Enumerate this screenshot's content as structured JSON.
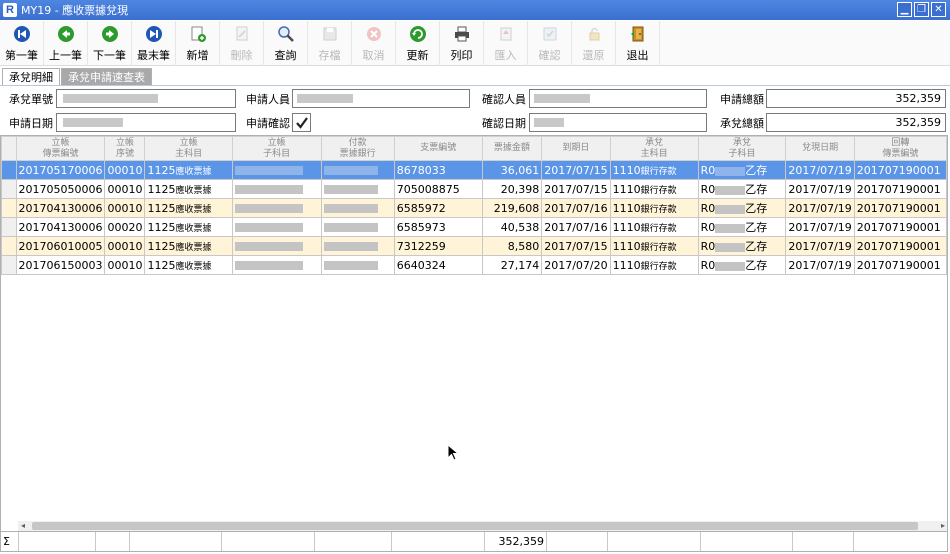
{
  "window": {
    "title": "MY19 - 應收票據兌現",
    "app_letter": "R"
  },
  "window_buttons": [
    "minimize-icon",
    "restore-icon",
    "close-icon"
  ],
  "toolbar": [
    {
      "label": "第一筆",
      "icon": "first-record-icon",
      "enabled": true
    },
    {
      "label": "上一筆",
      "icon": "previous-record-icon",
      "enabled": true
    },
    {
      "label": "下一筆",
      "icon": "next-record-icon",
      "enabled": true
    },
    {
      "label": "最末筆",
      "icon": "last-record-icon",
      "enabled": true
    },
    {
      "label": "新增",
      "icon": "add-document-icon",
      "enabled": true
    },
    {
      "label": "刪除",
      "icon": "delete-document-icon",
      "enabled": false
    },
    {
      "label": "查詢",
      "icon": "search-icon",
      "enabled": true
    },
    {
      "label": "存檔",
      "icon": "save-icon",
      "enabled": false
    },
    {
      "label": "取消",
      "icon": "cancel-icon",
      "enabled": false
    },
    {
      "label": "更新",
      "icon": "refresh-icon",
      "enabled": true
    },
    {
      "label": "列印",
      "icon": "printer-icon",
      "enabled": true
    },
    {
      "label": "匯入",
      "icon": "import-icon",
      "enabled": false
    },
    {
      "label": "確認",
      "icon": "confirm-icon",
      "enabled": false
    },
    {
      "label": "還原",
      "icon": "restore-lock-icon",
      "enabled": false
    },
    {
      "label": "退出",
      "icon": "exit-door-icon",
      "enabled": true
    }
  ],
  "tabs": [
    {
      "label": "承兌明細",
      "active": true
    },
    {
      "label": "承兌申請速查表",
      "active": false
    }
  ],
  "form": {
    "doc_no_label": "承兌單號",
    "apply_person_label": "申請人員",
    "confirm_person_label": "確認人員",
    "apply_total_label": "申請總額",
    "apply_total_value": "352,359",
    "apply_date_label": "申請日期",
    "apply_confirm_label": "申請確認",
    "apply_confirm_checked": true,
    "confirm_date_label": "確認日期",
    "honor_total_label": "承兌總額",
    "honor_total_value": "352,359"
  },
  "grid": {
    "headers": [
      [
        "立帳",
        "傳票編號"
      ],
      [
        "立帳",
        "序號"
      ],
      [
        "立帳",
        "主科目"
      ],
      [
        "立帳",
        "子科目"
      ],
      [
        "付款",
        "票據銀行"
      ],
      [
        "支票編號"
      ],
      [
        "票據金額"
      ],
      [
        "到期日"
      ],
      [
        "承兌",
        "主科目"
      ],
      [
        "承兌",
        "子科目"
      ],
      [
        "兌現日期"
      ],
      [
        "回轉",
        "傳票編號"
      ]
    ],
    "rows": [
      {
        "voucher": "201705170006",
        "seq": "00010",
        "main_code": "1125",
        "main_name": "應收票據",
        "cheque": "8678033",
        "amount": "36,061",
        "due": "2017/07/15",
        "h_main_code": "1110",
        "h_main_name": "銀行存款",
        "h_sub_prefix": "R0",
        "h_sub_suffix": "乙存",
        "cash_date": "2017/07/19",
        "rev_voucher": "201707190001",
        "style": "selected"
      },
      {
        "voucher": "201705050006",
        "seq": "00010",
        "main_code": "1125",
        "main_name": "應收票據",
        "cheque": "705008875",
        "amount": "20,398",
        "due": "2017/07/15",
        "h_main_code": "1110",
        "h_main_name": "銀行存款",
        "h_sub_prefix": "R0",
        "h_sub_suffix": "乙存",
        "cash_date": "2017/07/19",
        "rev_voucher": "201707190001",
        "style": "white"
      },
      {
        "voucher": "201704130006",
        "seq": "00010",
        "main_code": "1125",
        "main_name": "應收票據",
        "cheque": "6585972",
        "amount": "219,608",
        "due": "2017/07/16",
        "h_main_code": "1110",
        "h_main_name": "銀行存款",
        "h_sub_prefix": "R0",
        "h_sub_suffix": "乙存",
        "cash_date": "2017/07/19",
        "rev_voucher": "201707190001",
        "style": "alt"
      },
      {
        "voucher": "201704130006",
        "seq": "00020",
        "main_code": "1125",
        "main_name": "應收票據",
        "cheque": "6585973",
        "amount": "40,538",
        "due": "2017/07/16",
        "h_main_code": "1110",
        "h_main_name": "銀行存款",
        "h_sub_prefix": "R0",
        "h_sub_suffix": "乙存",
        "cash_date": "2017/07/19",
        "rev_voucher": "201707190001",
        "style": "white"
      },
      {
        "voucher": "201706010005",
        "seq": "00010",
        "main_code": "1125",
        "main_name": "應收票據",
        "cheque": "7312259",
        "amount": "8,580",
        "due": "2017/07/15",
        "h_main_code": "1110",
        "h_main_name": "銀行存款",
        "h_sub_prefix": "R0",
        "h_sub_suffix": "乙存",
        "cash_date": "2017/07/19",
        "rev_voucher": "201707190001",
        "style": "alt"
      },
      {
        "voucher": "201706150003",
        "seq": "00010",
        "main_code": "1125",
        "main_name": "應收票據",
        "cheque": "6640324",
        "amount": "27,174",
        "due": "2017/07/20",
        "h_main_code": "1110",
        "h_main_name": "銀行存款",
        "h_sub_prefix": "R0",
        "h_sub_suffix": "乙存",
        "cash_date": "2017/07/19",
        "rev_voucher": "201707190001",
        "style": "white"
      }
    ]
  },
  "footer": {
    "sigma": "Σ",
    "amount_total": "352,359"
  },
  "colors": {
    "titlebar": "#3a6fd0",
    "selected_row": "#5b95e8",
    "alt_row": "#fff3d8",
    "inactive_tab": "#a9a9a9"
  }
}
